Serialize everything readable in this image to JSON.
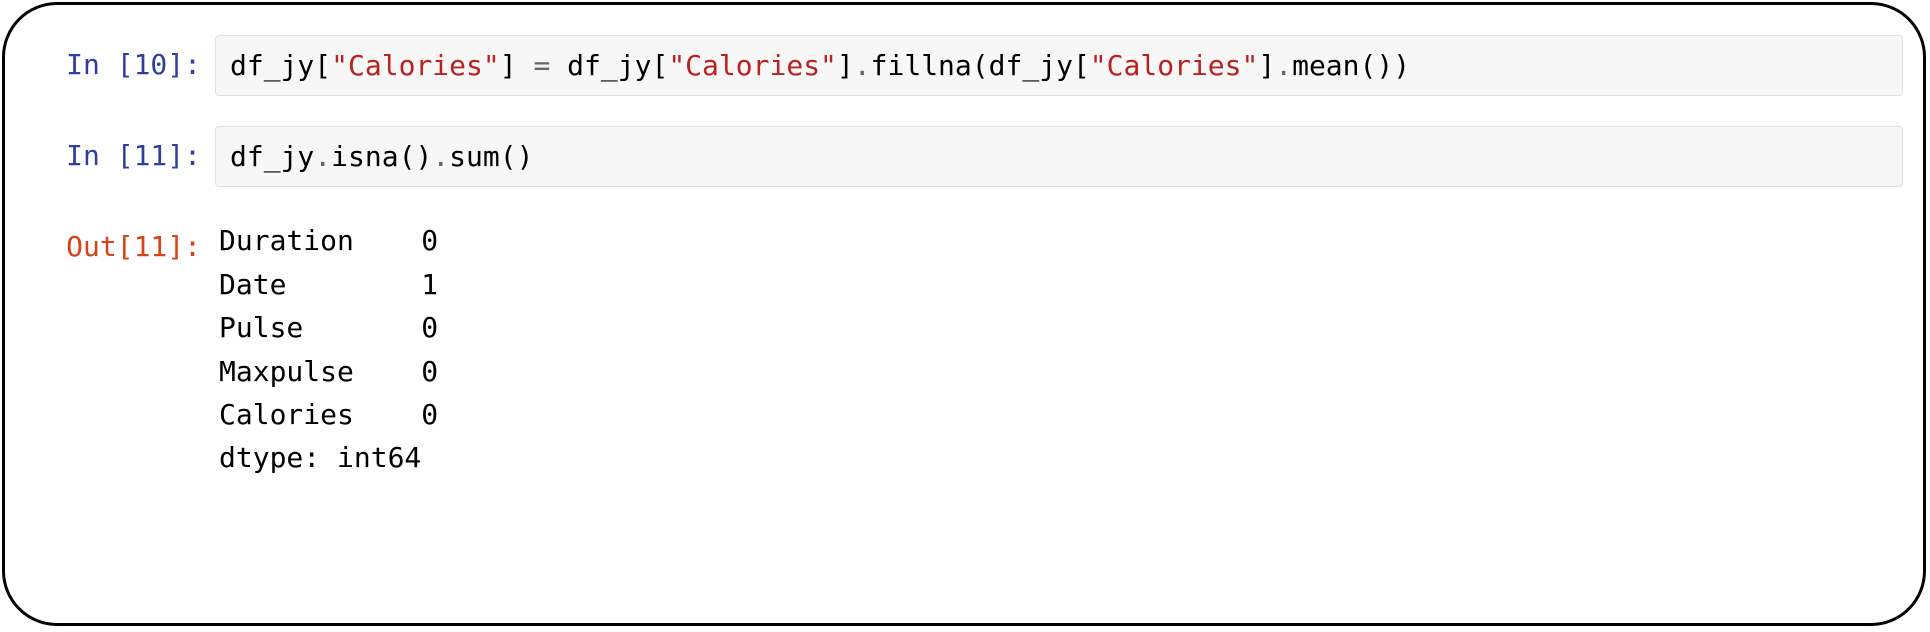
{
  "cells": [
    {
      "prompt_label": "In [10]:",
      "code": {
        "var1": "df_jy",
        "open_bracket1": "[",
        "str1": "\"Calories\"",
        "close_bracket1": "]",
        "space1": " ",
        "eq": "=",
        "space2": " ",
        "var2": "df_jy",
        "open_bracket2": "[",
        "str2": "\"Calories\"",
        "close_bracket2": "]",
        "dot1": ".",
        "method1": "fillna",
        "open_paren1": "(",
        "var3": "df_jy",
        "open_bracket3": "[",
        "str3": "\"Calories\"",
        "close_bracket3": "]",
        "dot2": ".",
        "method2": "mean",
        "open_paren2": "(",
        "close_paren2": ")",
        "close_paren1": ")"
      }
    },
    {
      "prompt_label": "In [11]:",
      "code": {
        "var1": "df_jy",
        "dot1": ".",
        "method1": "isna",
        "open_paren1": "(",
        "close_paren1": ")",
        "dot2": ".",
        "method2": "sum",
        "open_paren2": "(",
        "close_paren2": ")"
      }
    },
    {
      "prompt_label": "Out[11]:",
      "output_text": "Duration    0\nDate        1\nPulse       0\nMaxpulse    0\nCalories    0\ndtype: int64"
    }
  ]
}
